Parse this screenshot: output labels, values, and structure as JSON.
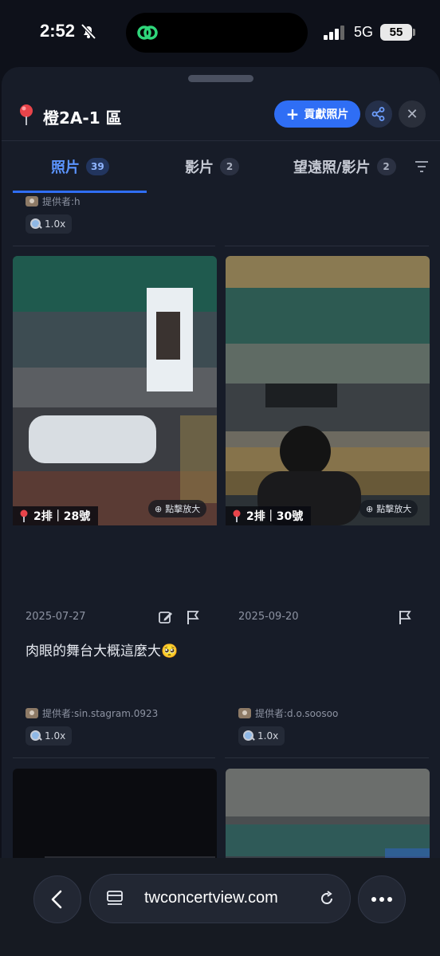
{
  "status": {
    "time": "2:52",
    "network": "5G",
    "battery": "55"
  },
  "header": {
    "zone": "橙2A-1 區",
    "contribute_label": "貢獻照片"
  },
  "tabs": [
    {
      "label": "照片",
      "count": "39"
    },
    {
      "label": "影片",
      "count": "2"
    },
    {
      "label": "望遠照/影片",
      "count": "2"
    }
  ],
  "top_card": {
    "provider": "提供者:h",
    "zoom": "1.0x"
  },
  "cards": [
    {
      "seat": "2排｜28號",
      "zoom_hint": "點擊放大",
      "date": "2025-07-27",
      "caption": "肉眼的舞台大概這麼大🥺",
      "provider": "提供者:sin.stagram.0923",
      "zoom": "1.0x"
    },
    {
      "seat": "2排｜30號",
      "zoom_hint": "點擊放大",
      "date": "2025-09-20",
      "caption": "",
      "provider": "提供者:d.o.soosoo",
      "zoom": "1.0x"
    }
  ],
  "browser": {
    "url": "twconcertview.com"
  },
  "colors": {
    "accent": "#2f6ef5",
    "background": "#171c28"
  }
}
